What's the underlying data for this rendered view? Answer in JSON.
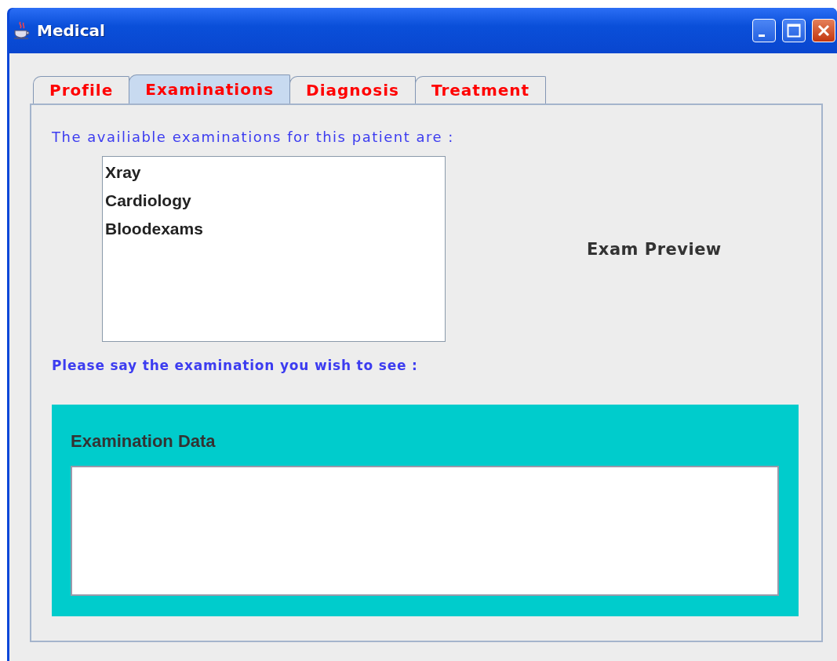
{
  "window": {
    "title": "Medical"
  },
  "tabs": [
    {
      "label": "Profile",
      "selected": false
    },
    {
      "label": "Examinations",
      "selected": true
    },
    {
      "label": "Diagnosis",
      "selected": false
    },
    {
      "label": "Treatment",
      "selected": false
    }
  ],
  "list_label": "The availiable examinations for this patient are :",
  "examinations": [
    {
      "label": "Xray",
      "selected": false
    },
    {
      "label": "Cardiology",
      "selected": false
    },
    {
      "label": "Bloodexams",
      "selected": false
    }
  ],
  "preview_label": "Exam Preview",
  "prompt": "Please say the examination you wish to see :",
  "data_panel": {
    "title": "Examination Data"
  }
}
